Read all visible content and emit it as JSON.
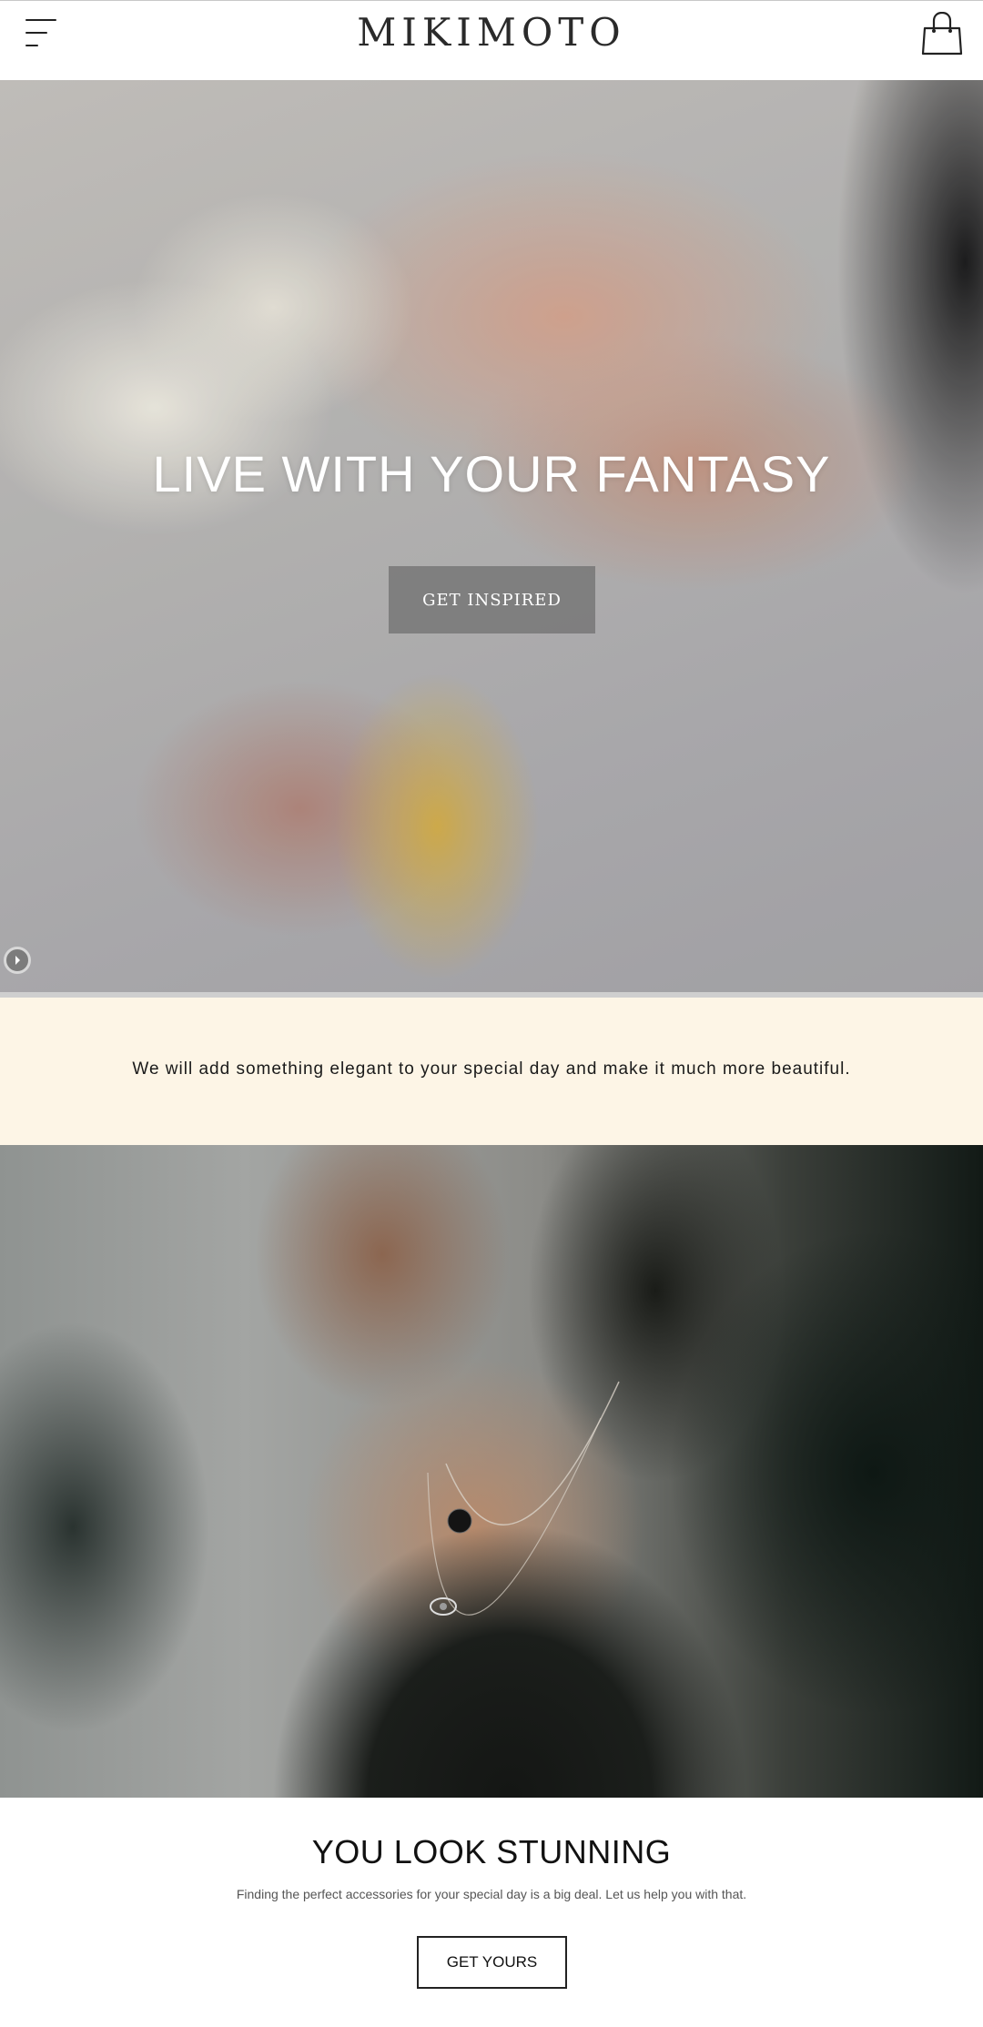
{
  "header": {
    "brand": "MIKIMOTO",
    "menu_icon": "hamburger-menu-icon",
    "bag_icon": "shopping-bag-icon"
  },
  "hero": {
    "title": "LIVE WITH YOUR FANTASY",
    "button_label": "GET INSPIRED",
    "slider_arrow_icon": "chevron-right-icon"
  },
  "tagline": {
    "text": "We will add something elegant to your special day and make it much more beautiful."
  },
  "feature": {
    "title": "YOU LOOK STUNNING",
    "subtitle": "Finding the perfect accessories for your special day is a big deal. Let us help you with that.",
    "button_label": "GET YOURS"
  },
  "colors": {
    "cream_band": "#fdf5e6",
    "text_dark": "#111111",
    "button_overlay": "#6e6e6e"
  }
}
